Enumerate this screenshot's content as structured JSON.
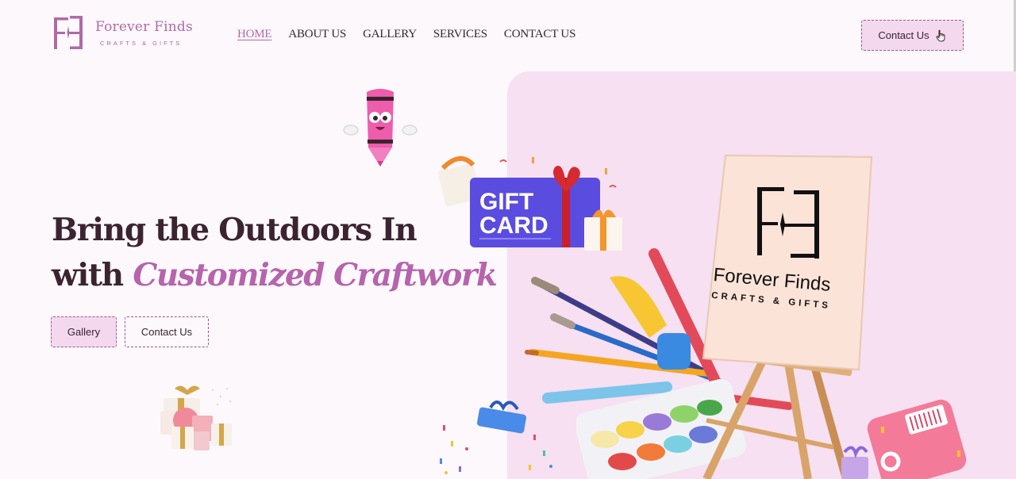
{
  "brand": {
    "name": "Forever Finds",
    "tagline": "CRAFTS & GIFTS",
    "monogram": "FF",
    "colors": {
      "accent": "#b06aa6",
      "panel": "#f6e0f1",
      "button_fill": "#f4d8ee",
      "heading": "#3b2430"
    }
  },
  "nav": {
    "items": [
      {
        "label": "HOME",
        "active": true
      },
      {
        "label": "ABOUT US",
        "active": false
      },
      {
        "label": "GALLERY",
        "active": false
      },
      {
        "label": "SERVICES",
        "active": false
      },
      {
        "label": "CONTACT US",
        "active": false
      }
    ]
  },
  "header": {
    "cta_label": "Contact Us",
    "cta_icon": "pointer-hand-icon"
  },
  "hero": {
    "title_line1": "Bring the Outdoors In",
    "title_line2_prefix": "with",
    "title_line2_accent": "Customized Craftwork",
    "buttons": {
      "gallery": "Gallery",
      "contact": "Contact Us"
    }
  },
  "illustration": {
    "gift_card_text_1": "GIFT",
    "gift_card_text_2": "CARD",
    "easel_brand_name": "Forever Finds",
    "easel_brand_tagline": "CRAFTS & GIFTS"
  }
}
